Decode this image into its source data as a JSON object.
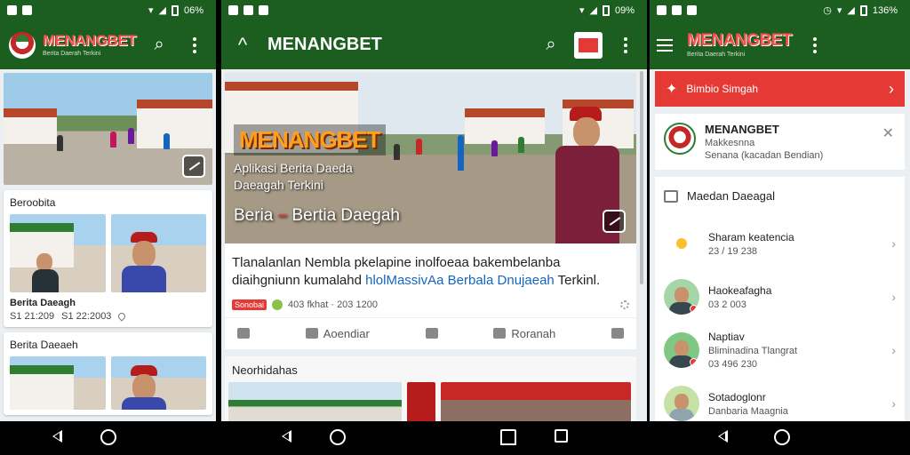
{
  "colors": {
    "appbar": "#1b5e20",
    "brand_red": "#ff4d4d",
    "accent_red": "#e53935",
    "link_blue": "#1565c0"
  },
  "phone1": {
    "status": {
      "signal": "signal-icon",
      "battery_text": "06%"
    },
    "brand": "MENANGBET",
    "brand_sub": "Berita Daerah Terkini",
    "card1": {
      "title": "Beroobita",
      "meta_title": "Berita Daeagh",
      "meta_a": "S1 21:209",
      "meta_b": "S1 22:2003"
    },
    "card2": {
      "title": "Berita Daeaeh"
    }
  },
  "phone2": {
    "status": {
      "battery_text": "09%"
    },
    "title": "MENANGBET",
    "hero": {
      "brand": "MENANGBET",
      "sub1": "Aplikasi Berita Daeda",
      "sub2": "Daeagah Terkini",
      "head_a": "Beria",
      "head_dash": "–",
      "head_b": "Bertia Daegah"
    },
    "article": {
      "text_a": "Tlanalanlan Nembla pkelapine inolfoeaa bakembelanba diaihgniunn kumalahd ",
      "link": "hlolMassivAa Berbala Dnujaeah",
      "text_b": " Terkinl.",
      "tag": "Sonobai",
      "meta": "403 fkhat · 203 1200"
    },
    "actions": [
      "Home",
      "Aoendiar",
      "Bagikan",
      "Roranah",
      "Kirim"
    ],
    "section_title": "Neorhidahas"
  },
  "phone3": {
    "status": {
      "battery_text": "136%"
    },
    "brand": "MENANGBET",
    "brand_sub": "Berita Daerah Terkini",
    "promo": "Bimbio Simgah",
    "notif": {
      "title": "MENANGBET",
      "line1": "Makkesnna",
      "line2": "Senana (kacadan Bendian)"
    },
    "list_head": "Maedan Daeagal",
    "rows": [
      {
        "title": "Sharam keatencia",
        "sub": "23 / 19 238"
      },
      {
        "title": "Haokeafagha",
        "sub": "03 2 003"
      },
      {
        "title": "Naptiav",
        "sub": "Bliminadina Tlangrat",
        "sub2": "03 496 230"
      },
      {
        "title": "Sotadoglonr",
        "sub": "Danbaria Maagnia"
      }
    ]
  },
  "navbar": {
    "items": [
      "back",
      "home",
      "recents"
    ]
  }
}
